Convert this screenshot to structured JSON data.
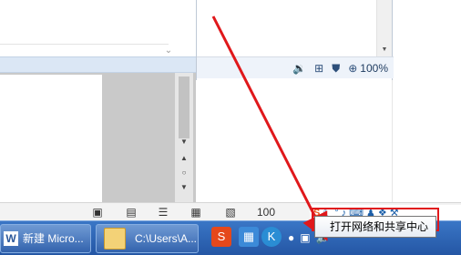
{
  "win2": {
    "zoom": "100%"
  },
  "word_status": {
    "zoom": "100"
  },
  "taskbar": {
    "word_label": "新建 Micro...",
    "explorer_label": "C:\\Users\\A..."
  },
  "tooltip": {
    "text": "打开网络和共享中心"
  },
  "colors": {
    "annotation": "#e0181b",
    "taskbar": "#2f63b3"
  }
}
